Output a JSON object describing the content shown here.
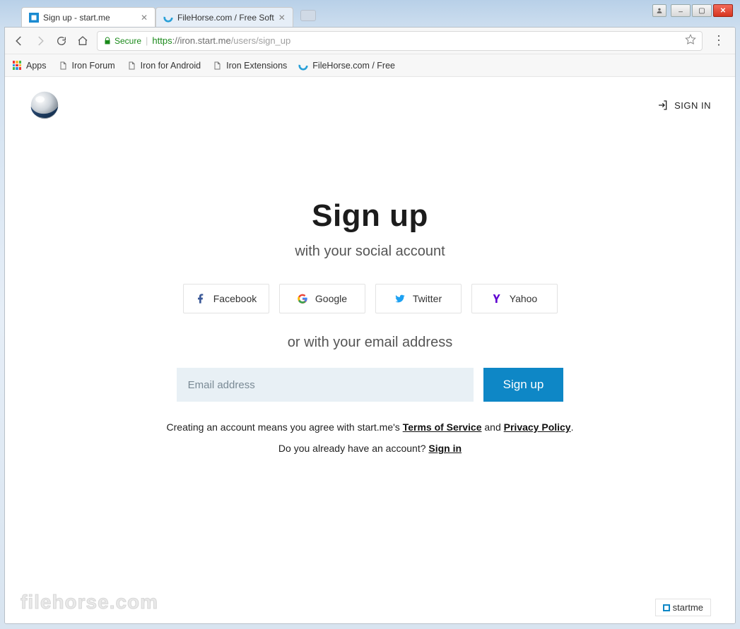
{
  "window": {
    "user_btn_icon": "user",
    "min_icon": "—",
    "max_icon": "❐",
    "close_icon": "✕"
  },
  "tabs": [
    {
      "title": "Sign up - start.me",
      "active": true
    },
    {
      "title": "FileHorse.com / Free Soft",
      "active": false
    }
  ],
  "addressbar": {
    "secure_label": "Secure",
    "url_scheme": "https",
    "url_host": "://iron.start.me",
    "url_path": "/users/sign_up"
  },
  "bookmarks": {
    "apps": "Apps",
    "items": [
      "Iron Forum",
      "Iron for Android",
      "Iron Extensions",
      "FileHorse.com / Free"
    ]
  },
  "page": {
    "signin_top": "SIGN IN",
    "title": "Sign up",
    "subtitle": "with your social account",
    "social": [
      "Facebook",
      "Google",
      "Twitter",
      "Yahoo"
    ],
    "or_label": "or with your email address",
    "email_placeholder": "Email address",
    "signup_btn": "Sign up",
    "legal_prefix": "Creating an account means you agree with start.me's ",
    "tos": "Terms of Service",
    "and": " and ",
    "privacy": "Privacy Policy",
    "legal_suffix": ".",
    "already_prefix": "Do you already have an account? ",
    "already_link": "Sign in",
    "watermark": "filehorse.com",
    "badge": "startme"
  }
}
